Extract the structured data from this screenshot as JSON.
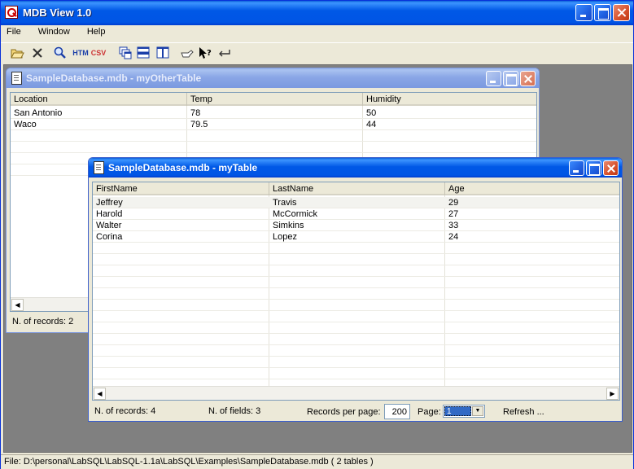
{
  "app": {
    "title": "MDB View 1.0",
    "menu": [
      {
        "label": "File"
      },
      {
        "label": "Window"
      },
      {
        "label": "Help"
      }
    ],
    "toolbar": {
      "open": "open-folder-icon",
      "close": "close-icon",
      "search": "magnifier-icon",
      "htm_label": "HTM",
      "csv_label": "CSV",
      "cascade": "cascade-windows-icon",
      "tile_h": "tile-horizontal-icon",
      "tile_v": "tile-vertical-icon",
      "hand": "hand-icon",
      "help": "context-help-icon",
      "back": "return-icon"
    },
    "status": "File: D:\\personal\\LabSQL\\LabSQL-1.1a\\LabSQL\\Examples\\SampleDatabase.mdb ( 2 tables )"
  },
  "other_window": {
    "title": "SampleDatabase.mdb - myOtherTable",
    "columns": [
      "Location",
      "Temp",
      "Humidity"
    ],
    "rows": [
      [
        "San Antonio",
        "78",
        "50"
      ],
      [
        "Waco",
        "79.5",
        "44"
      ]
    ],
    "records": "N. of records: 2"
  },
  "main_window": {
    "title": "SampleDatabase.mdb - myTable",
    "columns": [
      "FirstName",
      "LastName",
      "Age"
    ],
    "rows": [
      [
        "Jeffrey",
        "Travis",
        "29"
      ],
      [
        "Harold",
        "McCormick",
        "27"
      ],
      [
        "Walter",
        "Simkins",
        "33"
      ],
      [
        "Corina",
        "Lopez",
        "24"
      ]
    ],
    "records": "N. of records: 4",
    "fields": "N. of fields: 3",
    "rpp_label": "Records per page:",
    "rpp_value": "200",
    "page_label": "Page:",
    "page_value": "1",
    "refresh_label": "Refresh ..."
  }
}
